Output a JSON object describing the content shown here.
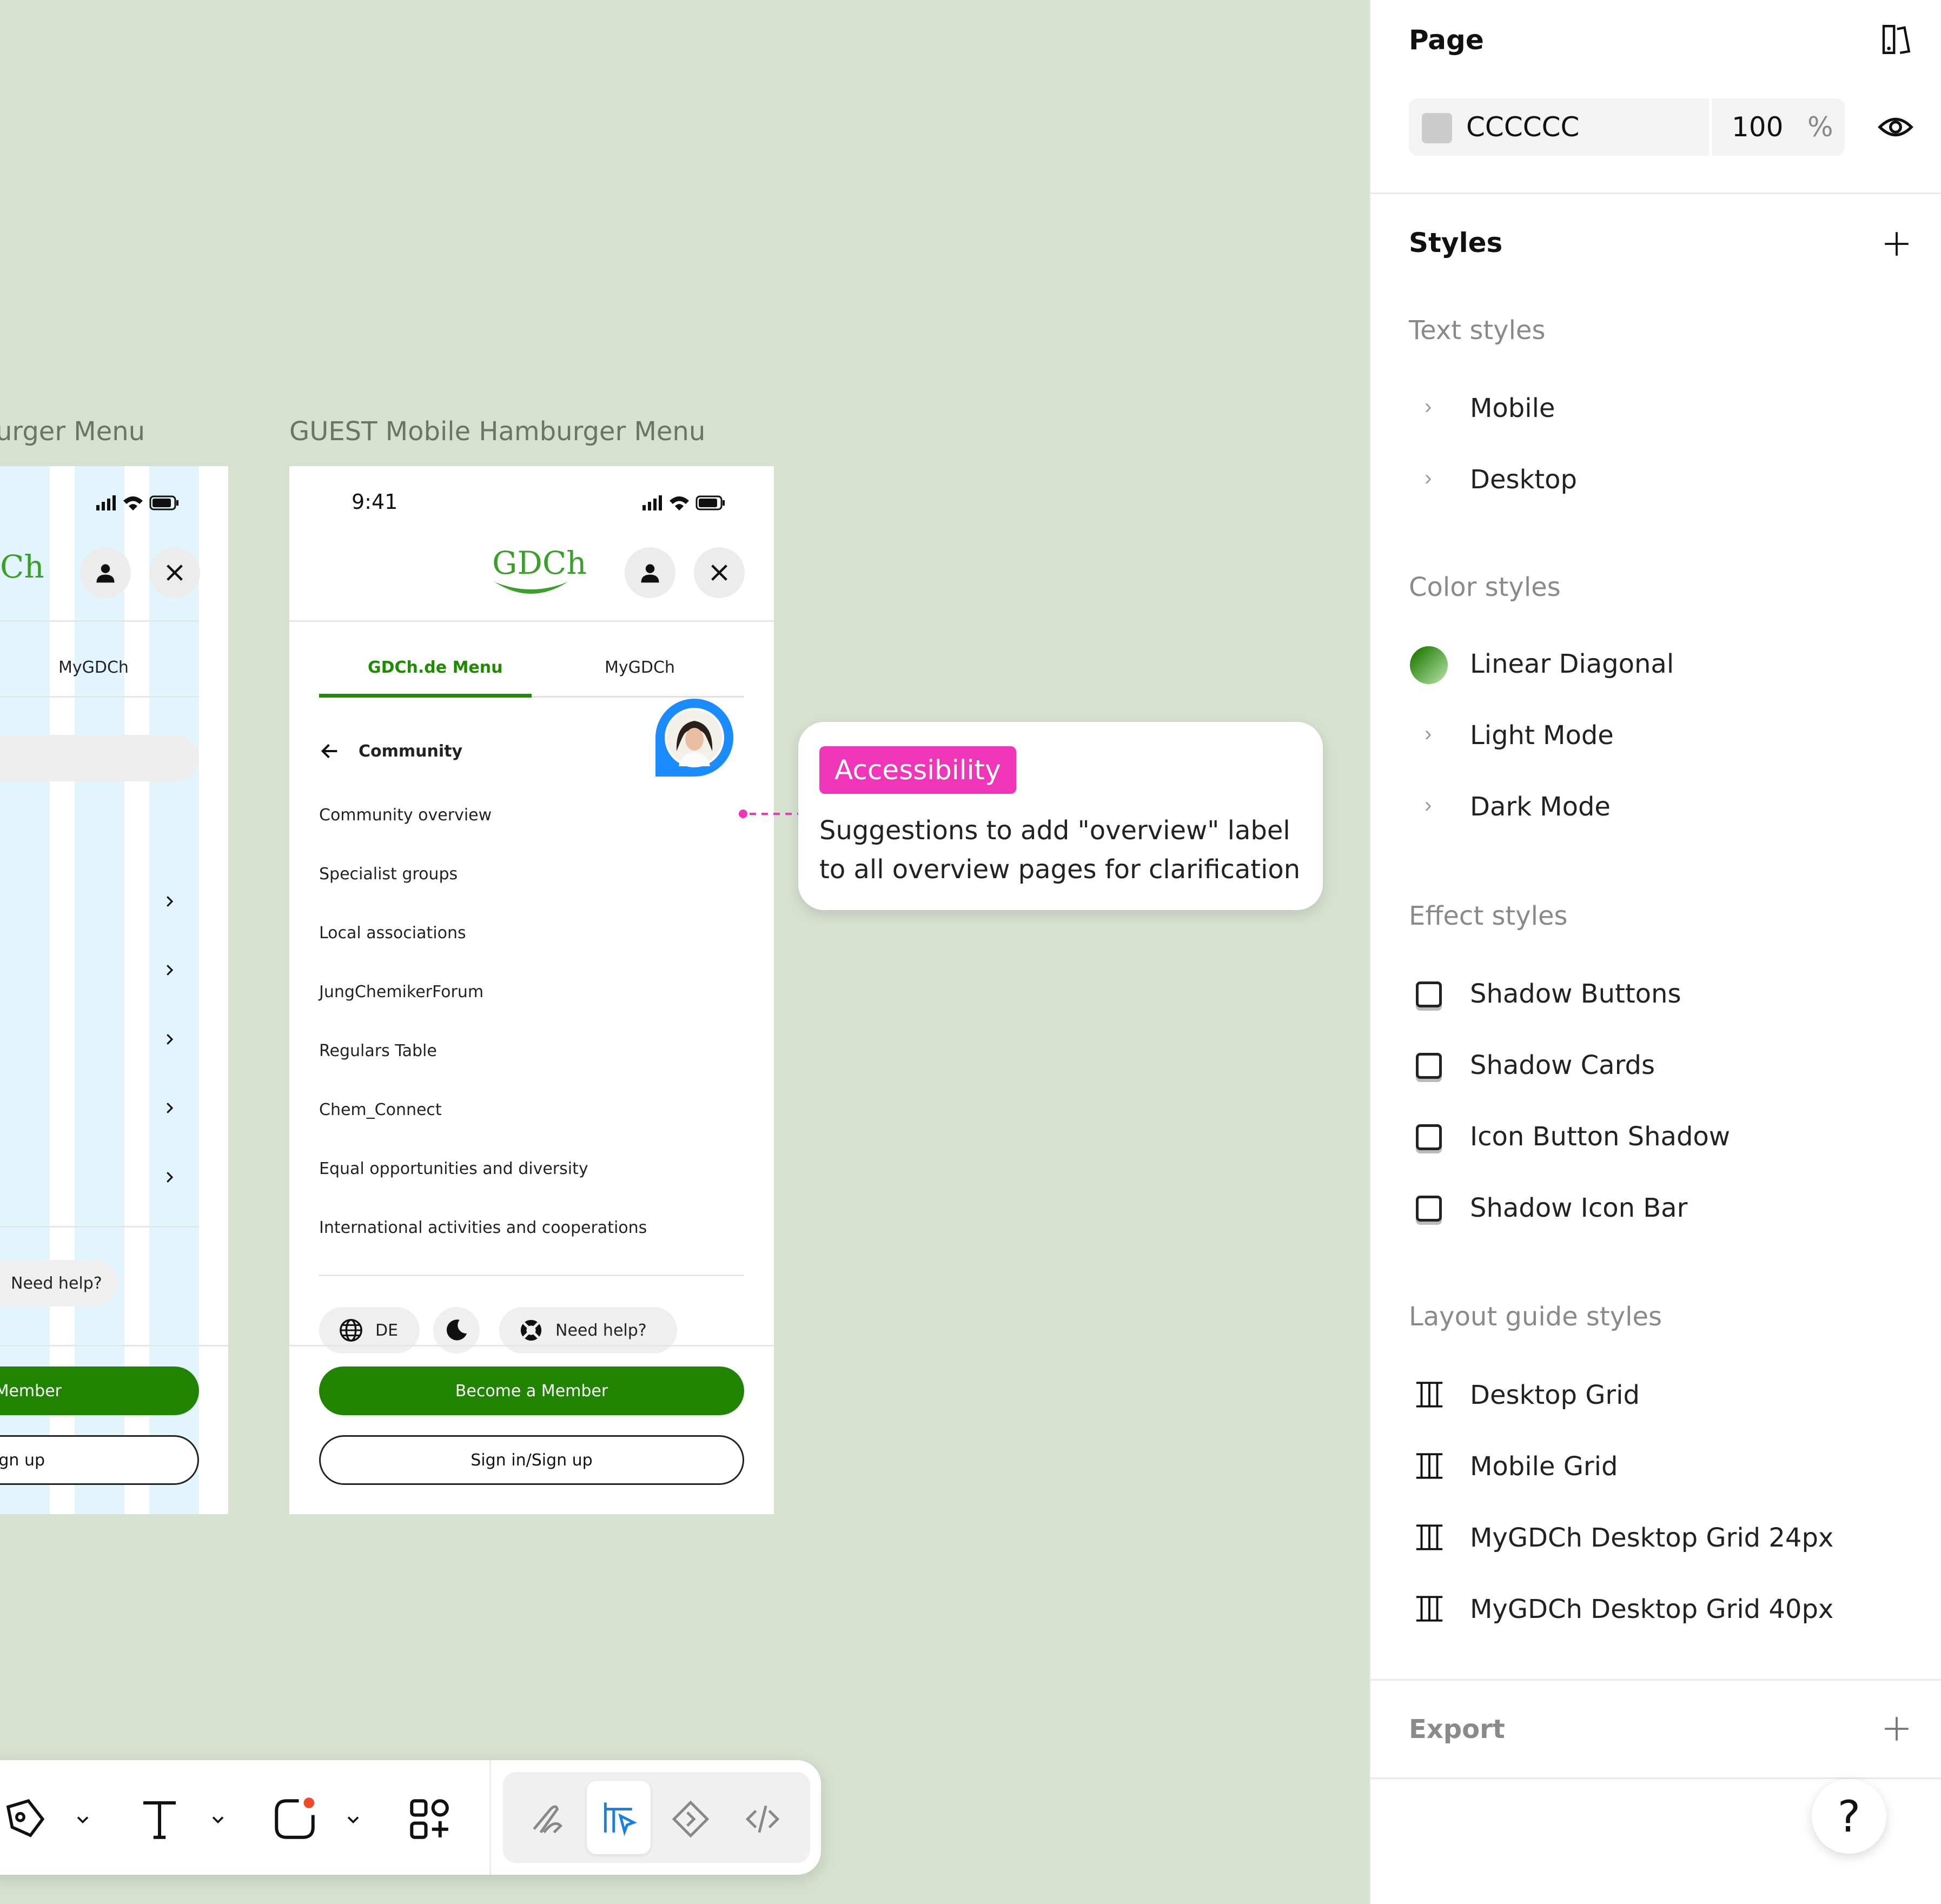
{
  "canvas": {
    "frames": {
      "left_title": "urger Menu",
      "main_title": "GUEST Mobile Hamburger Menu"
    },
    "left_phone": {
      "logo_partial": "Ch",
      "tab_mygdch": "MyGDCh",
      "need_help": "Need help?",
      "member_partial": "Member",
      "signup_partial": "ign up"
    },
    "main_phone": {
      "status_time": "9:41",
      "logo": "GDCh",
      "tabs": [
        "GDCh.de Menu",
        "MyGDCh"
      ],
      "back_label": "Community",
      "items": [
        "Community overview",
        "Specialist groups",
        "Local associations",
        "JungChemikerForum",
        "Regulars Table",
        "Chem_Connect",
        "Equal opportunities and diversity",
        "International activities and cooperations"
      ],
      "chips": {
        "language": "DE",
        "help": "Need help?"
      },
      "become_member": "Become a Member",
      "sign_in": "Sign in/Sign up"
    },
    "callout": {
      "tag": "Accessibility",
      "text": "Suggestions to add \"overview\" label to all overview pages for clarification"
    }
  },
  "panel": {
    "page": {
      "title": "Page",
      "color_hex": "CCCCCC",
      "swatch_color": "#cccccc",
      "opacity": "100",
      "opacity_unit": "%"
    },
    "styles": {
      "title": "Styles",
      "text_styles": {
        "label": "Text styles",
        "items": [
          "Mobile",
          "Desktop"
        ]
      },
      "color_styles": {
        "label": "Color styles",
        "items": [
          "Linear Diagonal",
          "Light Mode",
          "Dark Mode"
        ]
      },
      "effect_styles": {
        "label": "Effect styles",
        "items": [
          "Shadow Buttons",
          "Shadow Cards",
          "Icon Button Shadow",
          "Shadow Icon Bar"
        ]
      },
      "layout_styles": {
        "label": "Layout guide styles",
        "items": [
          "Desktop Grid",
          "Mobile Grid",
          "MyGDCh Desktop Grid 24px",
          "MyGDCh Desktop Grid 40px"
        ]
      }
    },
    "export": {
      "title": "Export"
    },
    "help": "?"
  },
  "colors": {
    "canvas_bg": "#d6e1d0",
    "brand_green": "#218400",
    "accent_pink": "#f036b8",
    "selection_blue": "#1a8cff"
  }
}
